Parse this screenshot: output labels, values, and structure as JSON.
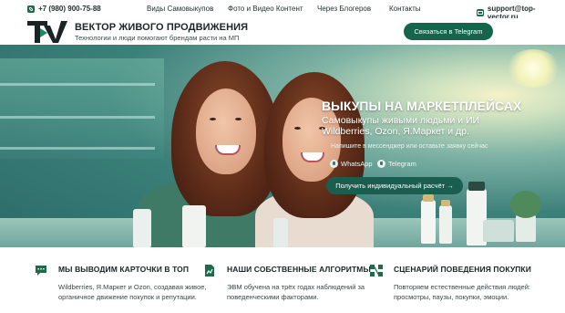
{
  "topbar": {
    "phone": "+7 (980) 900-75-88",
    "nav": [
      "Виды Самовыкупов",
      "Фото и Видео Контент",
      "Через Блогеров",
      "Контакты"
    ],
    "email": "support@top-vector.ru"
  },
  "header": {
    "logo_text": "TV",
    "title": "ВЕКТОР ЖИВОГО ПРОДВИЖЕНИЯ",
    "subtitle": "Технологии и люди помогают брендам расти на МП",
    "cta": "Связаться в Telegram"
  },
  "hero": {
    "title": "ВЫКУПЫ НА МАРКЕТПЛЕЙСАХ",
    "subtitle_line1": "Самовыкупы живыми людьми и ИИ",
    "subtitle_line2": "Wildberries, Ozon, Я.Маркет и др.",
    "note": "Напишите в мессенджер или оставьте заявку сейчас",
    "whatsapp": "WhatsApp",
    "telegram": "Telegram",
    "cta": "Получить индивидуальный расчёт →"
  },
  "features": [
    {
      "icon": "chat-bubble-icon",
      "title": "МЫ ВЫВОДИМ КАРТОЧКИ В ТОП",
      "line1": "Wildberries, Я.Маркет и Ozon, создавая живое,",
      "line2": "органичное движение покупок и репутации."
    },
    {
      "icon": "document-chart-icon",
      "title": "НАШИ СОБСТВЕННЫЕ АЛГОРИТМЫ",
      "line1": "ЭВМ обучена на трёх годах наблюдений за",
      "line2": "поведенческими факторами."
    },
    {
      "icon": "flow-diagram-icon",
      "title": "СЦЕНАРИЙ ПОВЕДЕНИЯ ПОКУПКИ",
      "line1": "Повторяем естественные действия людей:",
      "line2": "просмотры, паузы, покупки, эмоции."
    }
  ],
  "colors": {
    "brand_green": "#15654c",
    "hero_teal": "#3c807a"
  }
}
